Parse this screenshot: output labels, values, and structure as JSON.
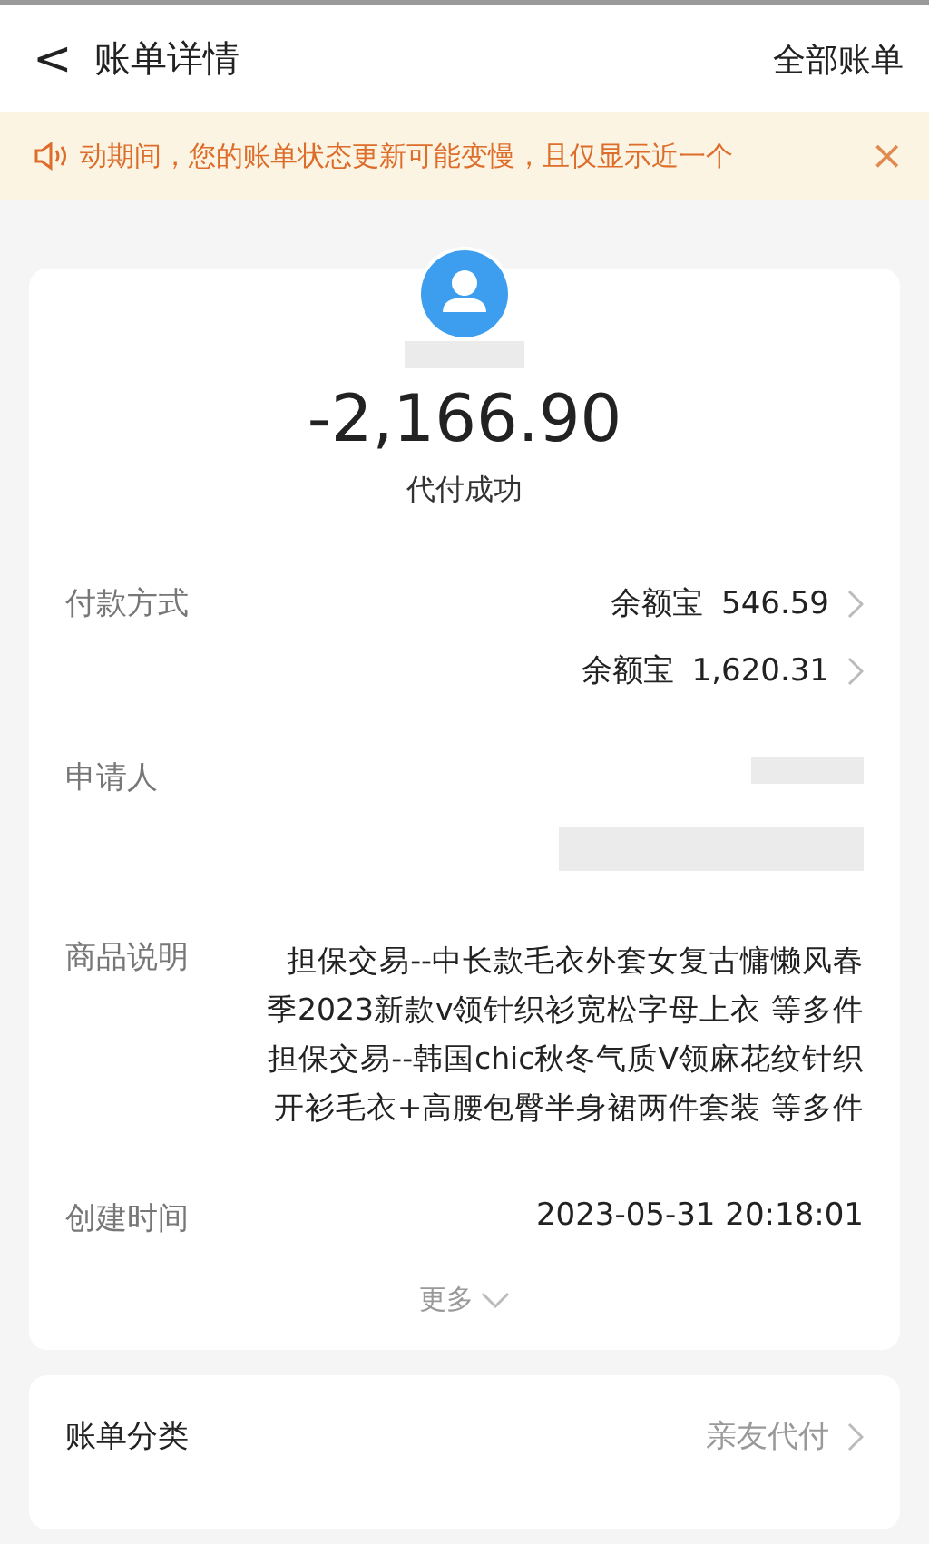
{
  "header": {
    "back": "<",
    "title": "账单详情",
    "action": "全部账单"
  },
  "notice": {
    "text": "动期间，您的账单状态更新可能变慢，且仅显示近一个",
    "close": "×"
  },
  "summary": {
    "name_redacted": true,
    "amount": "-2,166.90",
    "status": "代付成功"
  },
  "details": [
    {
      "kind": "payments",
      "label": "付款方式",
      "items": [
        {
          "method": "余额宝",
          "amount": "546.59"
        },
        {
          "method": "余额宝",
          "amount": "1,620.31"
        }
      ]
    },
    {
      "kind": "redacted",
      "label": "申请人",
      "redacted": true
    },
    {
      "kind": "lines",
      "label": "商品说明",
      "paragraphs": [
        [
          "担保交易--中长款毛衣外套女复古慵懒风春",
          "季2023新款v领针织衫宽松字母上衣 等多件"
        ],
        [
          "担保交易--韩国chic秋冬气质V领麻花纹针织",
          "开衫毛衣+高腰包臀半身裙两件套装 等多件"
        ]
      ]
    },
    {
      "kind": "text",
      "label": "创建时间",
      "value": "2023-05-31 20:18:01"
    }
  ],
  "more": "更多",
  "category": {
    "label": "账单分类",
    "value": "亲友代付"
  }
}
